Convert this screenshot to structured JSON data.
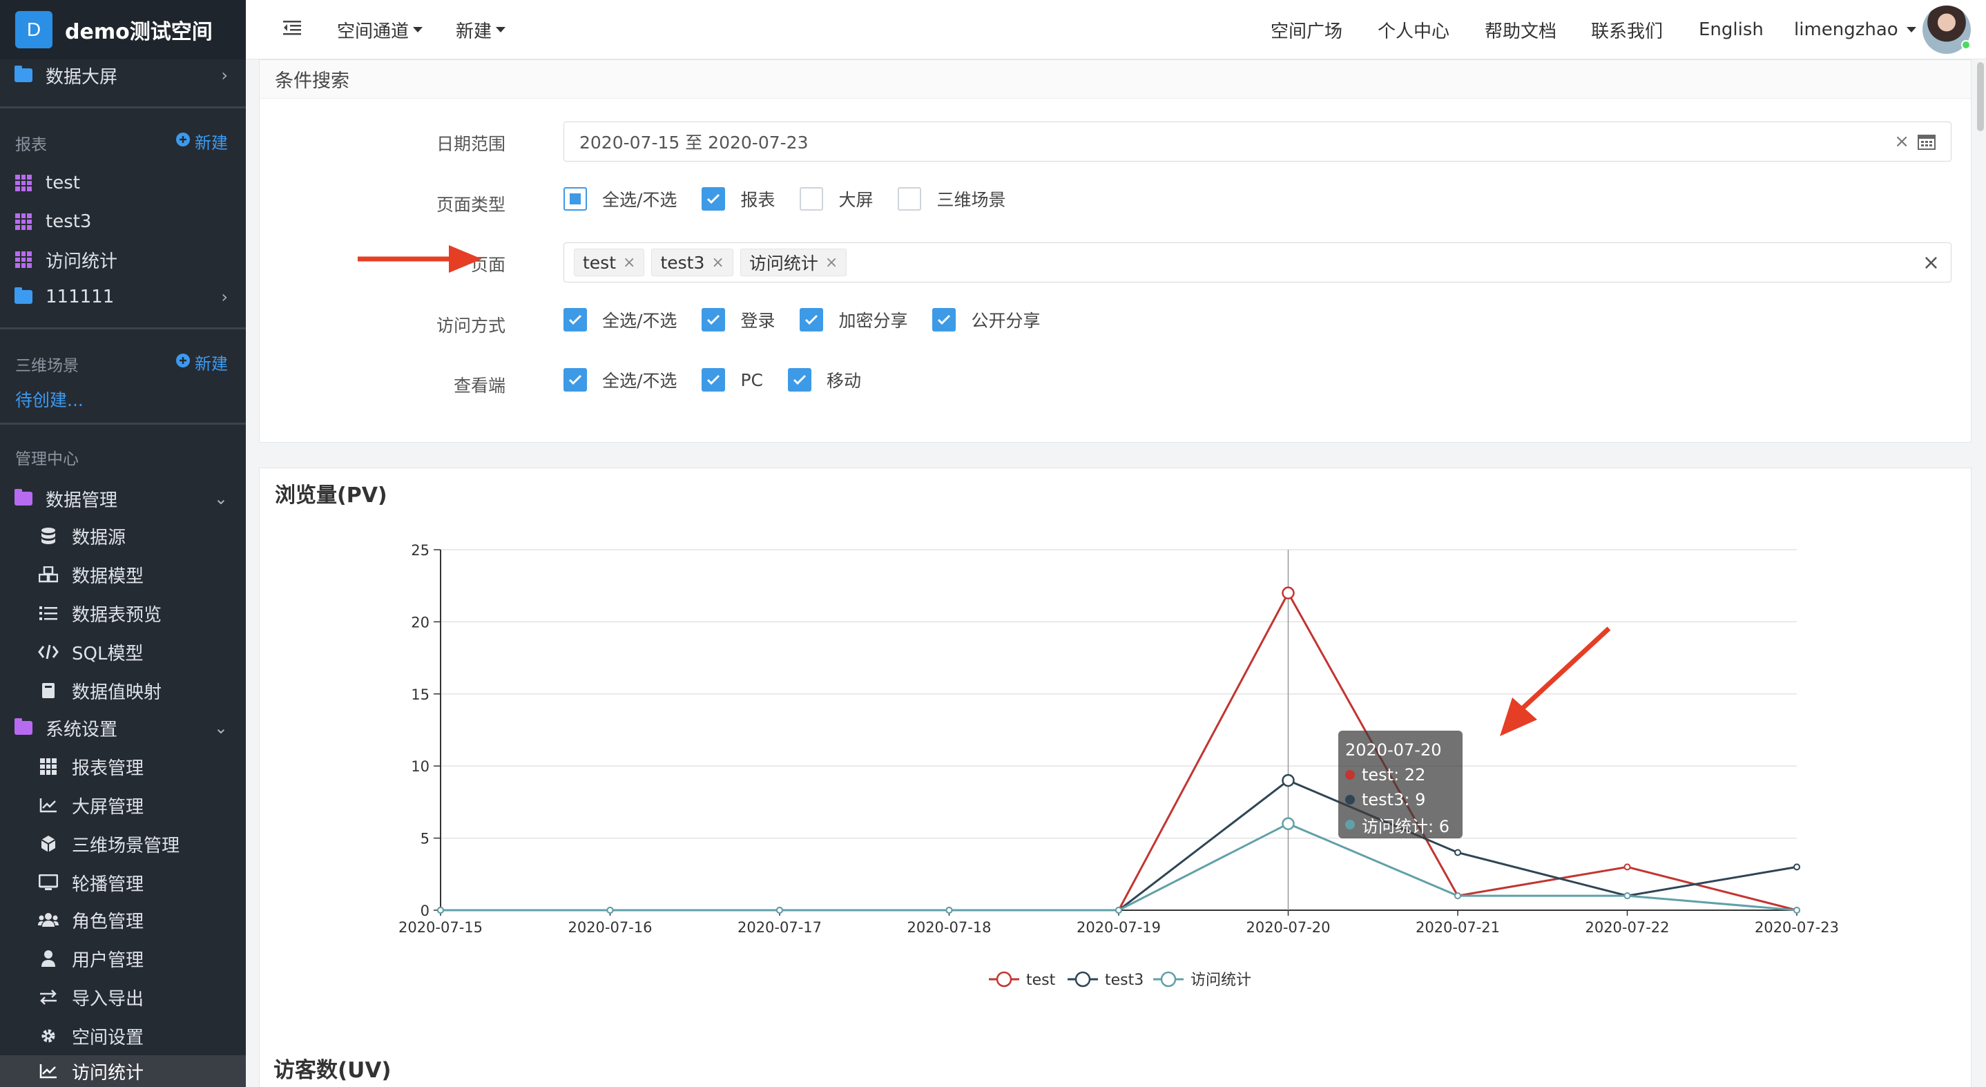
{
  "brand": {
    "logo": "D",
    "name": "demo测试空间"
  },
  "topbar": {
    "menu_icon": "indent-icon",
    "channel": "空间通道",
    "create": "新建",
    "links": [
      "空间广场",
      "个人中心",
      "帮助文档",
      "联系我们",
      "English"
    ],
    "user": "limengzhao"
  },
  "sidebar": {
    "data_screen": "数据大屏",
    "reports_section": "报表",
    "new_label": "新建",
    "reports": [
      "test",
      "test3",
      "访问统计"
    ],
    "folder_111": "111111",
    "scenes_section": "三维场景",
    "pending": "待创建...",
    "admin_section": "管理中心",
    "data_mgmt": "数据管理",
    "data_mgmt_items": [
      "数据源",
      "数据模型",
      "数据表预览",
      "SQL模型",
      "数据值映射"
    ],
    "sys_settings": "系统设置",
    "sys_items": [
      "报表管理",
      "大屏管理",
      "三维场景管理",
      "轮播管理",
      "角色管理",
      "用户管理",
      "导入导出",
      "空间设置",
      "访问统计"
    ]
  },
  "search": {
    "header": "条件搜索",
    "date_label": "日期范围",
    "date_value": "2020-07-15 至 2020-07-23",
    "type_label": "页面类型",
    "type_options": [
      "全选/不选",
      "报表",
      "大屏",
      "三维场景"
    ],
    "page_label": "页面",
    "page_tags": [
      "test",
      "test3",
      "访问统计"
    ],
    "access_label": "访问方式",
    "access_options": [
      "全选/不选",
      "登录",
      "加密分享",
      "公开分享"
    ],
    "viewer_label": "查看端",
    "viewer_options": [
      "全选/不选",
      "PC",
      "移动"
    ]
  },
  "pv_title": "浏览量(PV)",
  "uv_title": "访客数(UV)",
  "tooltip": {
    "date": "2020-07-20",
    "lines": [
      "test: 22",
      "test3: 9",
      "访问统计: 6"
    ]
  },
  "colors": {
    "test": "#c23531",
    "test3": "#2f4554",
    "visit": "#61a0a8",
    "accent": "#3d9ae6"
  },
  "chart_data": {
    "type": "line",
    "title": "浏览量(PV)",
    "x": [
      "2020-07-15",
      "2020-07-16",
      "2020-07-17",
      "2020-07-18",
      "2020-07-19",
      "2020-07-20",
      "2020-07-21",
      "2020-07-22",
      "2020-07-23"
    ],
    "yticks": [
      "0",
      "5",
      "10",
      "15",
      "20",
      "25"
    ],
    "ylim": [
      0,
      25
    ],
    "legend_position": "bottom-center",
    "series": [
      {
        "name": "test",
        "values": [
          0,
          0,
          0,
          0,
          0,
          22,
          1,
          3,
          0
        ]
      },
      {
        "name": "test3",
        "values": [
          0,
          0,
          0,
          0,
          0,
          9,
          4,
          1,
          3
        ]
      },
      {
        "name": "访问统计",
        "values": [
          0,
          0,
          0,
          0,
          0,
          6,
          1,
          1,
          0
        ]
      }
    ]
  }
}
